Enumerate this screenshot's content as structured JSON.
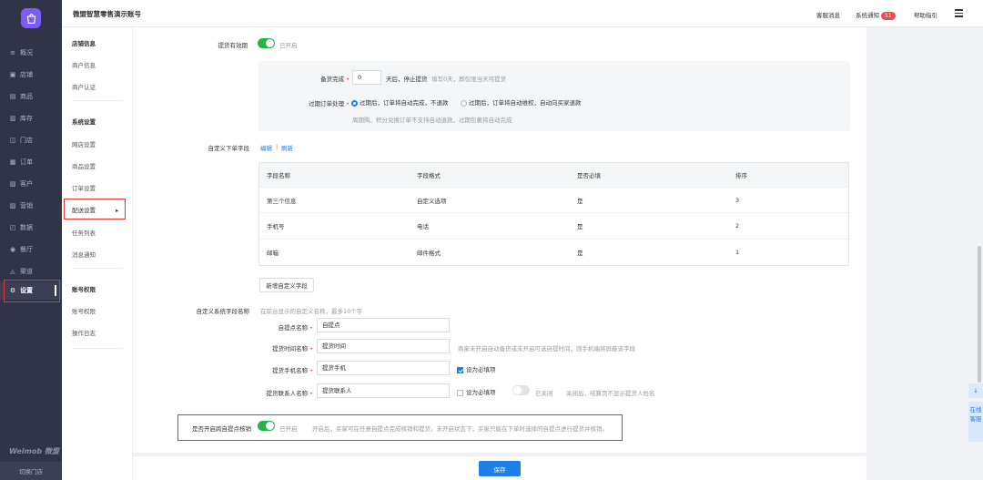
{
  "app": {
    "title": "微盟智慧零售演示账号",
    "brand": "Weimob 微盟",
    "switch_store": "切换门店"
  },
  "topbar": {
    "service": "客服消息",
    "notice": "系统通知",
    "notice_count": "51",
    "help": "帮助指引"
  },
  "sidebar": {
    "items": [
      {
        "icon": "≡",
        "label": "概况"
      },
      {
        "icon": "▣",
        "label": "店铺"
      },
      {
        "icon": "▤",
        "label": "商品"
      },
      {
        "icon": "▥",
        "label": "库存"
      },
      {
        "icon": "◫",
        "label": "门店"
      },
      {
        "icon": "▦",
        "label": "订单"
      },
      {
        "icon": "▧",
        "label": "客户"
      },
      {
        "icon": "▨",
        "label": "营销"
      },
      {
        "icon": "◰",
        "label": "数据"
      },
      {
        "icon": "◉",
        "label": "餐厅"
      },
      {
        "icon": "◬",
        "label": "渠道"
      },
      {
        "icon": "⚙",
        "label": "设置"
      }
    ]
  },
  "subnav": {
    "store_info": "店铺信息",
    "merchant_info": "商户信息",
    "merchant_auth": "商户认证",
    "system_settings": "系统设置",
    "website_settings": "网店设置",
    "product_settings": "商品设置",
    "order_settings": "订单设置",
    "delivery_settings": "配送设置",
    "task_list": "任务列表",
    "message_notice": "消息通知",
    "account_perm": "账号权限",
    "account_perm_sub": "账号权限",
    "operation_log": "操作日志"
  },
  "form": {
    "pickup_validity_label": "提货有效期",
    "pickup_validity_status": "已开启",
    "stock_done_label": "备货完成",
    "stock_days": "0",
    "stock_days_unit": "天后，停止提货",
    "stock_days_hint": "填写0天，即仅限当天可提货",
    "expired_label": "过期订单处理",
    "expired_opt1": "过期后，订单将自动完成，不退款",
    "expired_opt2": "过期后，订单将自动维权，自动向买家退款",
    "expired_hint": "周期购、积分兑换订单不支持自动退款，过期包裹将自动完成",
    "custom_fields_label": "自定义下单字段",
    "edit": "编辑",
    "refresh": "刷新",
    "table_headers": [
      "字段名称",
      "字段格式",
      "是否必填",
      "排序"
    ],
    "table_rows": [
      [
        "第三个信息",
        "自定义选项",
        "是",
        "3"
      ],
      [
        "手机号",
        "电话",
        "是",
        "2"
      ],
      [
        "邮箱",
        "邮件格式",
        "是",
        "1"
      ]
    ],
    "add_field": "新增自定义字段",
    "custom_sys_label": "自定义系统字段名称",
    "custom_sys_hint": "在前台显示的自定义名称，最多10个字",
    "pickup_name_label": "自提点名称",
    "pickup_name_value": "自提点",
    "pickup_time_label": "提货时间名称",
    "pickup_time_value": "提货时间",
    "pickup_time_hint": "商家未开启自动备货或未开启可选自提时间，则手机端将屏蔽该字段",
    "pickup_phone_label": "提货手机名称",
    "pickup_phone_value": "提货手机",
    "pickup_phone_required": "设为必填项",
    "pickup_contact_label": "提货联系人名称",
    "pickup_contact_value": "提货联系人",
    "pickup_contact_required": "设为必填项",
    "pickup_contact_status": "已关闭",
    "pickup_contact_hint": "关闭后，结算页不显示提货人姓名",
    "cross_store_label": "是否开启跨自提点核销",
    "cross_store_status": "已开启",
    "cross_store_hint": "开启后，买家可在任意自提点完成核销和提货。未开启状态下，买家只能在下单时选择的自提点进行提货并核销。",
    "save": "保存"
  },
  "float": {
    "download": "↓",
    "online_service": "在线客服"
  },
  "colors": {
    "accent": "#1e7fe6",
    "toggle_on": "#24b24b",
    "highlight": "#e8342a",
    "sidebar_bg": "#2f3447"
  }
}
